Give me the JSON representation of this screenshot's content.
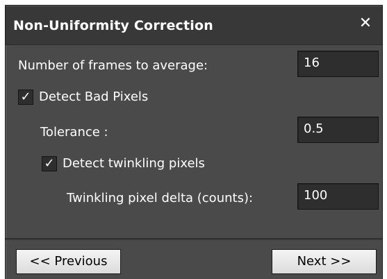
{
  "dialog": {
    "title": "Non-Uniformity Correction",
    "close_glyph": "✕"
  },
  "frames": {
    "label": "Number of frames to average:",
    "value": "16"
  },
  "bad_pixels": {
    "label": "Detect Bad Pixels",
    "checked": true,
    "check_glyph": "✓"
  },
  "tolerance": {
    "label": "Tolerance :",
    "value": "0.5"
  },
  "twinkling": {
    "label": "Detect twinkling pixels",
    "checked": true,
    "check_glyph": "✓"
  },
  "twinkling_delta": {
    "label": "Twinkling pixel delta (counts):",
    "value": "100"
  },
  "buttons": {
    "previous": "<< Previous",
    "next": "Next >>"
  },
  "colors": {
    "panel_bg": "#4a4a4a",
    "titlebar_bg": "#383838",
    "field_bg": "#2e2e2e",
    "text": "#ffffff"
  }
}
